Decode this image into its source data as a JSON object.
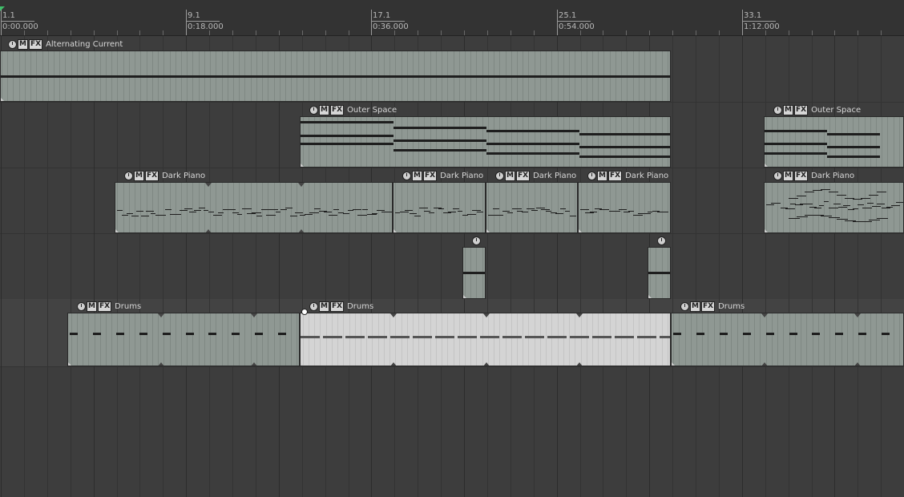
{
  "ruler": {
    "markers": [
      {
        "bar": "1.1",
        "time": "0:00.000"
      },
      {
        "bar": "9.1",
        "time": "0:18.000"
      },
      {
        "bar": "17.1",
        "time": "0:36.000"
      },
      {
        "bar": "25.1",
        "time": "0:54.000"
      },
      {
        "bar": "33.1",
        "time": "1:12.000"
      }
    ]
  },
  "item_buttons": {
    "mute": "M",
    "fx": "FX"
  },
  "tracks": [
    {
      "name": "track-1",
      "items": [
        {
          "name": "Alternating Current"
        }
      ]
    },
    {
      "name": "track-2",
      "items": [
        {
          "name": "Outer Space"
        },
        {
          "name": "Outer Space"
        }
      ]
    },
    {
      "name": "track-3",
      "items": [
        {
          "name": "Dark Piano"
        },
        {
          "name": "Dark Piano"
        },
        {
          "name": "Dark Piano"
        },
        {
          "name": "Dark Piano"
        },
        {
          "name": "Dark Piano"
        }
      ]
    },
    {
      "name": "track-4",
      "items": [
        {
          "name": ""
        },
        {
          "name": ""
        }
      ]
    },
    {
      "name": "track-5",
      "items": [
        {
          "name": "Drums"
        },
        {
          "name": "Drums",
          "selected": true
        },
        {
          "name": "Drums"
        }
      ]
    }
  ],
  "colors": {
    "item": "#8f9893",
    "selected_item": "#d4d4d4",
    "background": "#3d3d3d"
  }
}
